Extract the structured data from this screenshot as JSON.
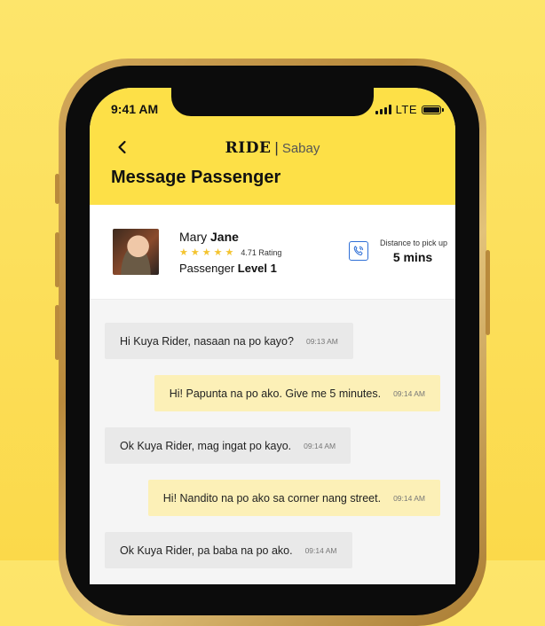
{
  "status_bar": {
    "time": "9:41 AM",
    "network": "LTE"
  },
  "header": {
    "brand": "RIDE",
    "separator": "|",
    "sub_brand": "Sabay",
    "title": "Message Passenger"
  },
  "passenger": {
    "first_name": "Mary",
    "last_name": "Jane",
    "rating_stars": 5,
    "rating_text": "4.71 Rating",
    "level_prefix": "Passenger",
    "level": "Level 1"
  },
  "distance": {
    "label": "Distance to pick up",
    "value": "5 mins"
  },
  "messages": [
    {
      "from": "passenger",
      "text": "Hi Kuya Rider, nasaan na po kayo?",
      "time": "09:13 AM"
    },
    {
      "from": "rider",
      "text": "Hi! Papunta na po ako. Give me 5 minutes.",
      "time": "09:14 AM"
    },
    {
      "from": "passenger",
      "text": "Ok Kuya Rider, mag ingat po kayo.",
      "time": "09:14 AM"
    },
    {
      "from": "rider",
      "text": "Hi! Nandito na po ako sa corner nang street.",
      "time": "09:14 AM"
    },
    {
      "from": "passenger",
      "text": "Ok Kuya Rider, pa baba na po ako.",
      "time": "09:14 AM"
    }
  ],
  "colors": {
    "background": "#fde56b",
    "header": "#fde047",
    "incoming_bubble": "#e9e9e9",
    "outgoing_bubble": "#fcf0b7",
    "star": "#f4c430",
    "call_icon": "#2f6fd6"
  },
  "icons": {
    "back": "chevron-left-icon",
    "call": "phone-call-icon",
    "star": "star-icon",
    "signal": "signal-icon",
    "battery": "battery-icon"
  }
}
